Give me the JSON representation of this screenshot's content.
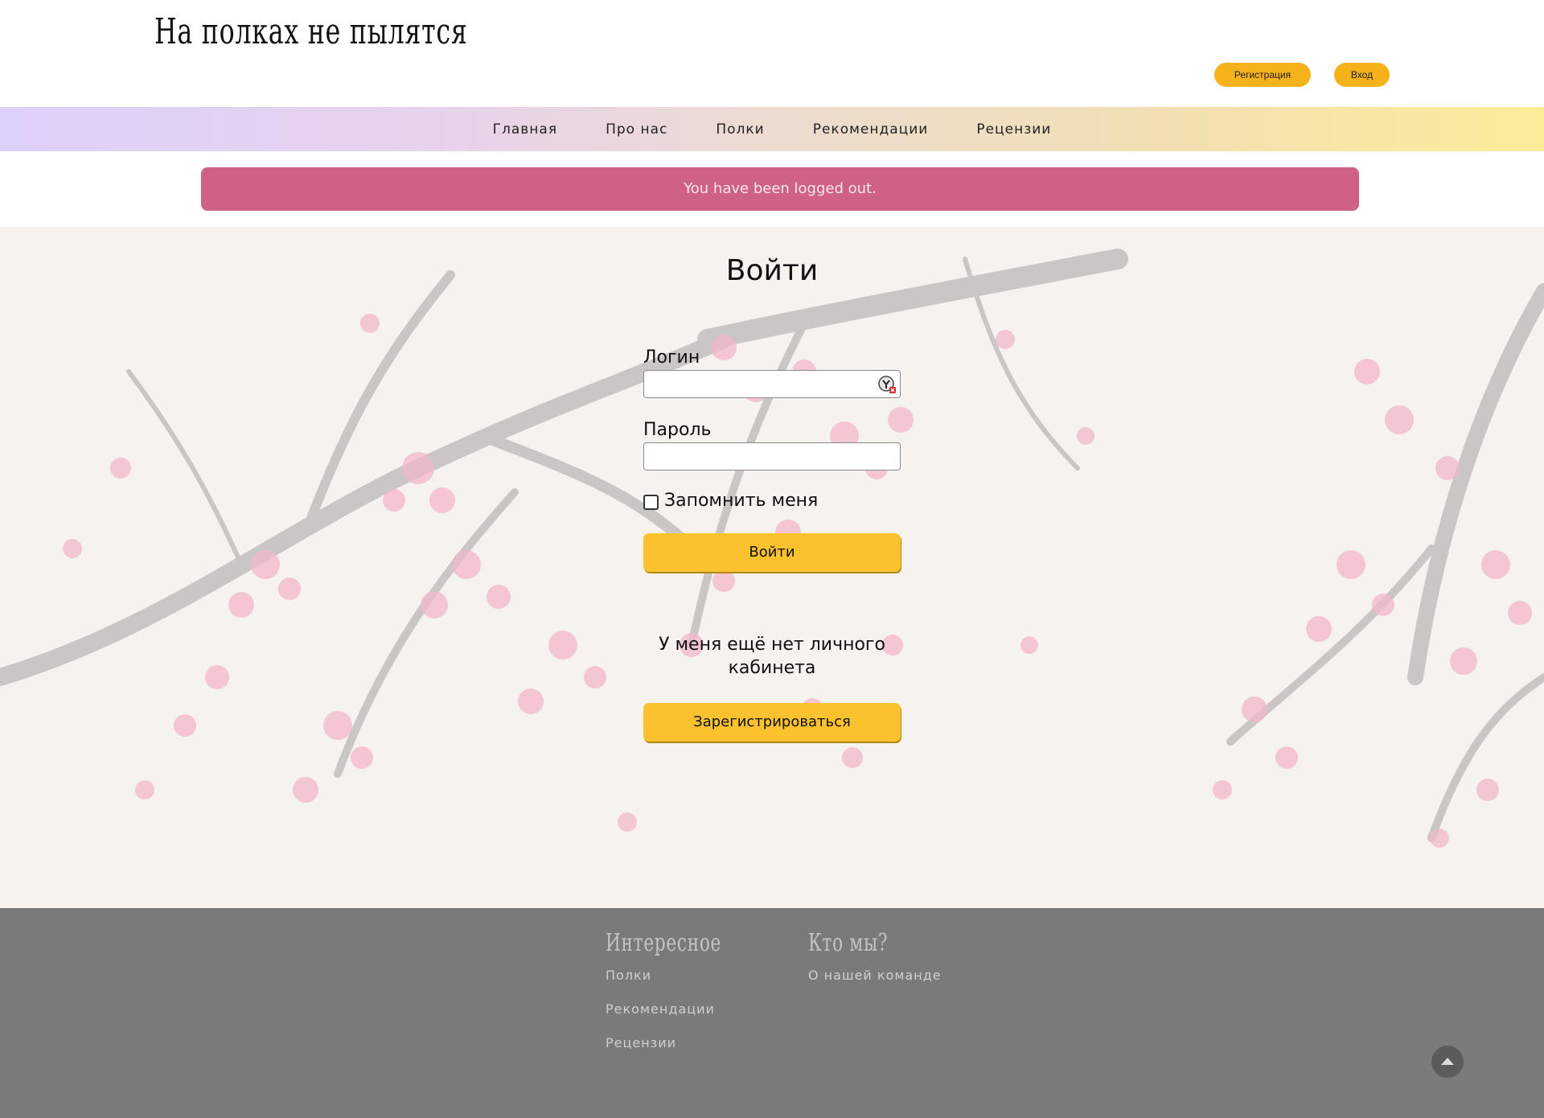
{
  "header": {
    "site_title": "На полках не пылятся",
    "register_label": "Регистрация",
    "login_label": "Вход"
  },
  "nav": {
    "items": [
      {
        "label": "Главная"
      },
      {
        "label": "Про нас"
      },
      {
        "label": "Полки"
      },
      {
        "label": "Рекомендации"
      },
      {
        "label": "Рецензии"
      }
    ]
  },
  "alert": {
    "message": "You have been logged out."
  },
  "login_form": {
    "title": "Войти",
    "login_label": "Логин",
    "login_value": "",
    "password_label": "Пароль",
    "password_value": "",
    "remember_label": "Запомнить меня",
    "remember_checked": false,
    "submit_label": "Войти",
    "no_account_text": "У меня ещё нет личного кабинета",
    "register_label": "Зарегистрироваться"
  },
  "footer": {
    "col1_title": "Интересное",
    "col1_links": [
      {
        "label": "Полки"
      },
      {
        "label": "Рекомендации"
      },
      {
        "label": "Рецензии"
      }
    ],
    "col2_title": "Кто мы?",
    "col2_links": [
      {
        "label": "О нашей команде"
      }
    ]
  },
  "colors": {
    "accent": "#fbc22f",
    "alert": "#cf6283",
    "footer": "#7a7a7a",
    "nav_gradient_start": "#ddd0fb",
    "nav_gradient_end": "#fcec98"
  },
  "icons": {
    "scroll_top": "chevron-up-icon",
    "password_manager": "password-manager-icon"
  }
}
